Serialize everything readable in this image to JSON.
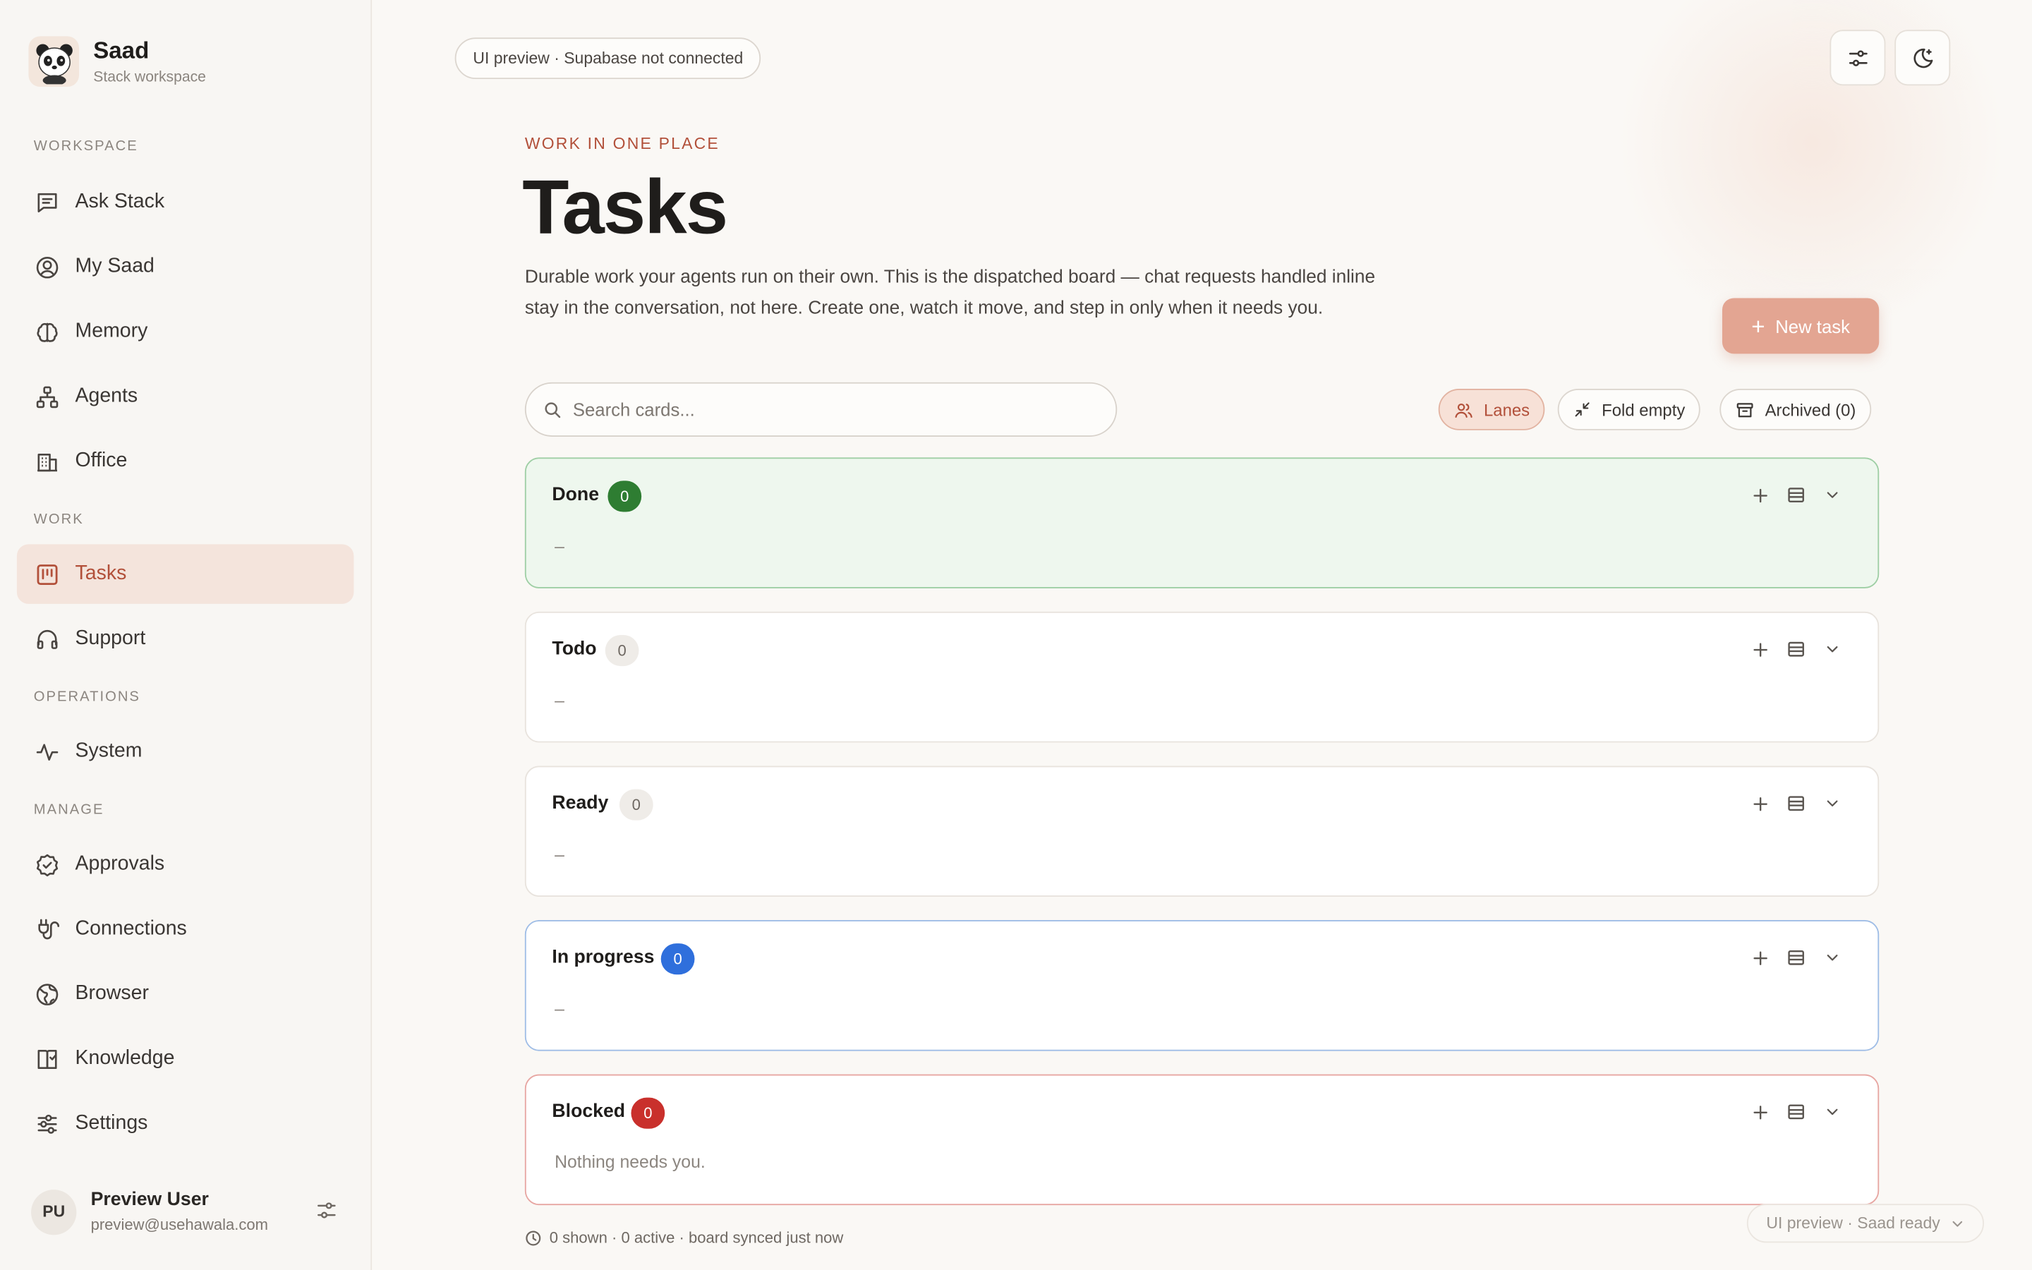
{
  "brand": {
    "name": "Saad",
    "subtitle": "Stack workspace"
  },
  "sidebar": {
    "sections": [
      {
        "label": "Workspace"
      },
      {
        "label": "Work"
      },
      {
        "label": "Operations"
      },
      {
        "label": "Manage"
      }
    ],
    "items": [
      {
        "label": "Ask Stack",
        "icon": "chat-icon"
      },
      {
        "label": "My Saad",
        "icon": "user-circle-icon"
      },
      {
        "label": "Memory",
        "icon": "brain-icon"
      },
      {
        "label": "Agents",
        "icon": "hierarchy-icon"
      },
      {
        "label": "Office",
        "icon": "building-icon"
      },
      {
        "label": "Tasks",
        "icon": "kanban-icon",
        "active": true
      },
      {
        "label": "Support",
        "icon": "headphones-icon"
      },
      {
        "label": "System",
        "icon": "pulse-icon"
      },
      {
        "label": "Approvals",
        "icon": "check-badge-icon"
      },
      {
        "label": "Connections",
        "icon": "plug-icon"
      },
      {
        "label": "Browser",
        "icon": "globe-icon"
      },
      {
        "label": "Knowledge",
        "icon": "book-icon"
      },
      {
        "label": "Settings",
        "icon": "sliders-icon"
      }
    ]
  },
  "user": {
    "initials": "PU",
    "name": "Preview User",
    "email": "preview@usehawala.com"
  },
  "header": {
    "preview_pill": "UI preview · Supabase not connected",
    "eyebrow": "Work in one place",
    "title": "Tasks",
    "description": "Durable work your agents run on their own. This is the dispatched board — chat requests handled inline stay in the conversation, not here. Create one, watch it move, and step in only when it needs you.",
    "new_task_label": "New task"
  },
  "toolbar": {
    "search_placeholder": "Search cards...",
    "lanes_label": "Lanes",
    "fold_empty_label": "Fold empty",
    "archived_label": "Archived (0)"
  },
  "lanes": [
    {
      "title": "Done",
      "count": "0",
      "empty_text": "–"
    },
    {
      "title": "Todo",
      "count": "0",
      "empty_text": "–"
    },
    {
      "title": "Ready",
      "count": "0",
      "empty_text": "–"
    },
    {
      "title": "In progress",
      "count": "0",
      "empty_text": "–"
    },
    {
      "title": "Blocked",
      "count": "0",
      "empty_text": "Nothing needs you."
    }
  ],
  "footer": {
    "stats": "0 shown · 0 active · board synced just now",
    "status_pill": "UI preview · Saad ready"
  },
  "colors": {
    "accent": "#b2503a",
    "done": "#2e7d32",
    "in_progress": "#2f6fdc",
    "blocked": "#c9302c"
  }
}
